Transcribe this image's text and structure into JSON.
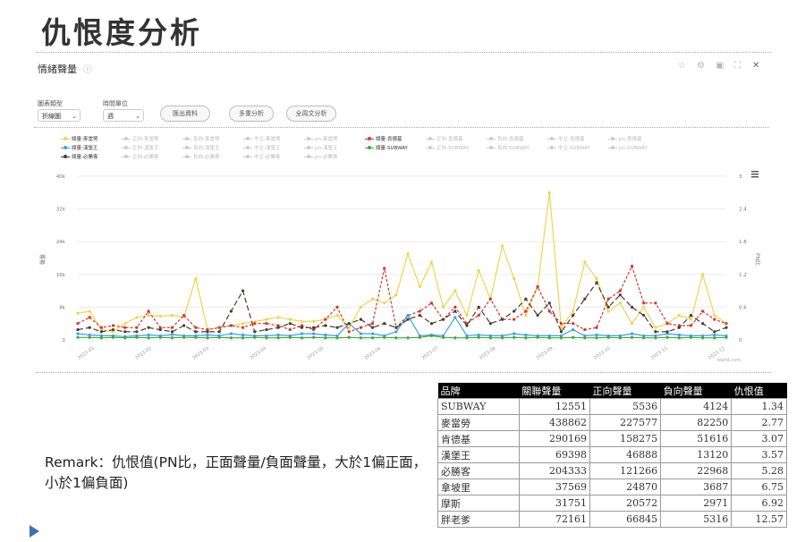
{
  "slide_title": "仇恨度分析",
  "panel": {
    "title": "情緒聲量",
    "controls": {
      "chart_type_label": "圖表類型",
      "chart_type_value": "折線圖",
      "time_unit_label": "時間單位",
      "time_unit_value": "週",
      "export_button": "匯出資料",
      "multi_analysis_button": "多重分析",
      "fulltext_button": "全周文分析"
    },
    "legend": [
      {
        "label": "總量-麥當勞",
        "color": "#f2d34f",
        "active": true
      },
      {
        "label": "正向-麥當勞",
        "color": "#cccccc",
        "active": false
      },
      {
        "label": "負向-麥當勞",
        "color": "#cccccc",
        "active": false
      },
      {
        "label": "中立-麥當勞",
        "color": "#cccccc",
        "active": false
      },
      {
        "label": "pn-麥當勞",
        "color": "#cccccc",
        "active": false
      },
      {
        "label": "總量-肯德基",
        "color": "#d9342b",
        "active": true
      },
      {
        "label": "正向-肯德基",
        "color": "#cccccc",
        "active": false
      },
      {
        "label": "負向-肯德基",
        "color": "#cccccc",
        "active": false
      },
      {
        "label": "中立-肯德基",
        "color": "#cccccc",
        "active": false
      },
      {
        "label": "pn-肯德基",
        "color": "#cccccc",
        "active": false
      },
      {
        "label": "總量-漢堡王",
        "color": "#3aa0e8",
        "active": true
      },
      {
        "label": "正向-漢堡王",
        "color": "#cccccc",
        "active": false
      },
      {
        "label": "負向-漢堡王",
        "color": "#cccccc",
        "active": false
      },
      {
        "label": "中立-漢堡王",
        "color": "#cccccc",
        "active": false
      },
      {
        "label": "pn-漢堡王",
        "color": "#cccccc",
        "active": false
      },
      {
        "label": "總量-SUBWAY",
        "color": "#3cab3c",
        "active": true
      },
      {
        "label": "正向-SUBWAY",
        "color": "#cccccc",
        "active": false
      },
      {
        "label": "負向-SUBWAY",
        "color": "#cccccc",
        "active": false
      },
      {
        "label": "中立-SUBWAY",
        "color": "#cccccc",
        "active": false
      },
      {
        "label": "pn-SUBWAY",
        "color": "#cccccc",
        "active": false
      },
      {
        "label": "總量-必勝客",
        "color": "#4a3c32",
        "active": true
      },
      {
        "label": "正向-必勝客",
        "color": "#cccccc",
        "active": false
      },
      {
        "label": "負向-必勝客",
        "color": "#cccccc",
        "active": false
      },
      {
        "label": "中立-必勝客",
        "color": "#cccccc",
        "active": false
      },
      {
        "label": "pn-必勝客",
        "color": "#cccccc",
        "active": false
      }
    ],
    "watermark": "eland.com",
    "menu_icon": "hamburger-icon"
  },
  "chart_data": {
    "type": "line",
    "left_axis": {
      "ticks": [
        "0",
        "8k",
        "16k",
        "24k",
        "32k",
        "40k"
      ],
      "label": "聲量",
      "ylim": [
        0,
        40000
      ]
    },
    "right_axis": {
      "ticks": [
        "0",
        "0.6",
        "1.2",
        "1.8",
        "2.4",
        "3"
      ],
      "label": "PN比",
      "ylim": [
        0,
        3
      ]
    },
    "x_ticks": [
      "2023-01",
      "2023-02",
      "2023-03",
      "2023-04",
      "2023-05",
      "2023-06",
      "2023-07",
      "2023-08",
      "2023-09",
      "2023-10",
      "2023-11",
      "2023-12"
    ],
    "series": [
      {
        "name": "總量-麥當勞",
        "color": "#f2d34f",
        "dash": "none",
        "values": [
          6500,
          7000,
          2500,
          2000,
          4000,
          5500,
          6000,
          5800,
          6000,
          5500,
          15000,
          2500,
          3000,
          3500,
          4000,
          4500,
          5000,
          5500,
          5000,
          4500,
          4500,
          5000,
          6000,
          3000,
          8000,
          10000,
          9000,
          11000,
          21000,
          13000,
          19000,
          8000,
          12000,
          6000,
          17000,
          10000,
          23000,
          15000,
          6000,
          13000,
          36000,
          3000,
          7000,
          19000,
          15000,
          7000,
          9000,
          4000,
          8000,
          3000,
          4000,
          6000,
          5000,
          16000,
          6000,
          4000
        ]
      },
      {
        "name": "總量-肯德基",
        "color": "#d9342b",
        "dash": "3,2",
        "values": [
          4000,
          5500,
          3000,
          3500,
          3000,
          3000,
          7000,
          3000,
          3000,
          6000,
          3000,
          2500,
          3000,
          3500,
          3000,
          4000,
          4000,
          3500,
          2500,
          3500,
          2500,
          5000,
          8000,
          2000,
          3000,
          4000,
          17500,
          3000,
          6000,
          7000,
          9000,
          5000,
          8000,
          4000,
          6000,
          10000,
          5000,
          5000,
          7000,
          13000,
          7000,
          4000,
          4000,
          2500,
          3000,
          10000,
          12000,
          18000,
          9000,
          9000,
          4000,
          3500,
          3500,
          7000,
          5000,
          4000
        ]
      },
      {
        "name": "總量-漢堡王",
        "color": "#3aa0e8",
        "dash": "none",
        "values": [
          1500,
          1200,
          1000,
          1000,
          800,
          1000,
          1200,
          1000,
          1300,
          1000,
          1000,
          1200,
          1000,
          1500,
          1200,
          1000,
          1000,
          1200,
          1000,
          1500,
          1500,
          1200,
          1000,
          4000,
          1500,
          1500,
          1000,
          2000,
          6000,
          1000,
          1200,
          1000,
          5500,
          1000,
          1200,
          1000,
          1000,
          1500,
          1200,
          1000,
          1000,
          1000,
          2500,
          1000,
          1200,
          1000,
          1000,
          1500,
          1000,
          1000,
          1500,
          1200,
          1000,
          1000,
          1200,
          1000
        ]
      },
      {
        "name": "總量-SUBWAY",
        "color": "#3cab3c",
        "dash": "none",
        "values": [
          600,
          600,
          500,
          600,
          500,
          600,
          500,
          600,
          500,
          600,
          600,
          500,
          600,
          500,
          500,
          600,
          500,
          500,
          600,
          500,
          600,
          500,
          500,
          600,
          500,
          500,
          600,
          500,
          500,
          600,
          1000,
          600,
          500,
          500,
          600,
          500,
          500,
          600,
          500,
          600,
          500,
          500,
          600,
          500,
          500,
          600,
          500,
          600,
          500,
          500,
          600,
          500,
          600,
          500,
          500,
          600
        ]
      },
      {
        "name": "總量-必勝客",
        "color": "#4a3c32",
        "dash": "6,3",
        "values": [
          2500,
          3000,
          2000,
          2500,
          2000,
          2000,
          3000,
          2500,
          2000,
          3500,
          2000,
          2000,
          2000,
          7000,
          12000,
          2000,
          2500,
          3000,
          4000,
          3000,
          3000,
          3500,
          3000,
          4000,
          5000,
          3000,
          4000,
          3000,
          5000,
          6000,
          4000,
          5000,
          7000,
          3500,
          8000,
          4000,
          5000,
          7000,
          10000,
          6000,
          9000,
          2000,
          6000,
          10000,
          14000,
          8000,
          11000,
          8000,
          6000,
          2000,
          2000,
          3000,
          6000,
          4000,
          2000,
          3000
        ]
      }
    ]
  },
  "remark": "Remark：仇恨值(PN比，正面聲量/負面聲量，大於1偏正面，小於1偏負面)",
  "table": {
    "headers": [
      "品牌",
      "關聯聲量",
      "正向聲量",
      "負向聲量",
      "仇恨值"
    ],
    "rows": [
      [
        "SUBWAY",
        "12551",
        "5536",
        "4124",
        "1.34"
      ],
      [
        "麥當勞",
        "438862",
        "227577",
        "82250",
        "2.77"
      ],
      [
        "肯德基",
        "290169",
        "158275",
        "51616",
        "3.07"
      ],
      [
        "漢堡王",
        "69398",
        "46888",
        "13120",
        "3.57"
      ],
      [
        "必勝客",
        "204333",
        "121266",
        "22968",
        "5.28"
      ],
      [
        "拿坡里",
        "37569",
        "24870",
        "3687",
        "6.75"
      ],
      [
        "摩斯",
        "31751",
        "20572",
        "2971",
        "6.92"
      ],
      [
        "胖老爹",
        "72161",
        "66845",
        "5316",
        "12.57"
      ]
    ]
  }
}
